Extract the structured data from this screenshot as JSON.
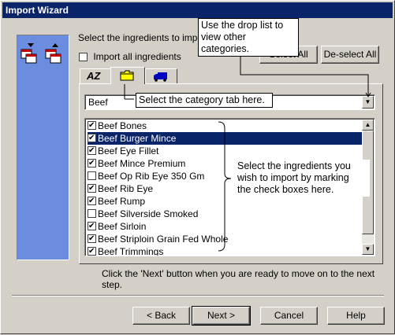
{
  "window": {
    "title": "Import Wizard",
    "close_glyph": "×"
  },
  "side_panel": {
    "icon_names": [
      "export-tables-icon",
      "import-tables-icon"
    ]
  },
  "instruction": "Select the ingredients to import.",
  "import_all": {
    "label": "Import all ingredients",
    "checked": false
  },
  "buttons": {
    "select_all": "Select All",
    "deselect_all": "De-select All"
  },
  "tabs": [
    {
      "name": "alphabetical-tab",
      "icon": "az-sort-icon",
      "glyph": "AZ"
    },
    {
      "name": "category-tab",
      "icon": "folder-icon",
      "active": true
    },
    {
      "name": "supplier-tab",
      "icon": "truck-icon"
    }
  ],
  "category_select": {
    "value": "Beef"
  },
  "ingredients": [
    {
      "label": "Beef Bones",
      "checked": true,
      "selected": false
    },
    {
      "label": "Beef Burger Mince",
      "checked": true,
      "selected": true
    },
    {
      "label": "Beef Eye Fillet",
      "checked": true,
      "selected": false
    },
    {
      "label": "Beef Mince Premium",
      "checked": true,
      "selected": false
    },
    {
      "label": "Beef Op Rib Eye 350 Gm",
      "checked": false,
      "selected": false
    },
    {
      "label": "Beef Rib Eye",
      "checked": true,
      "selected": false
    },
    {
      "label": "Beef Rump",
      "checked": true,
      "selected": false
    },
    {
      "label": "Beef Silverside Smoked",
      "checked": false,
      "selected": false
    },
    {
      "label": "Beef Sirloin",
      "checked": true,
      "selected": false
    },
    {
      "label": "Beef Striploin Grain Fed Whole",
      "checked": true,
      "selected": false
    },
    {
      "label": "Beef Trimmings",
      "checked": true,
      "selected": false
    }
  ],
  "callouts": {
    "droplist_line1": "Use the drop list to",
    "droplist_line2": "view other categories.",
    "category_tab": "Select the category tab here.",
    "checkbox_line1": "Select the ingredients you",
    "checkbox_line2": "wish to import by marking",
    "checkbox_line3": "the check boxes here."
  },
  "footer_hint": "Click the 'Next' button when you are ready to move on to the next step.",
  "nav_buttons": {
    "back": "< Back",
    "next": "Next >",
    "cancel": "Cancel",
    "help": "Help"
  },
  "colors": {
    "title_bar": "#0a246a",
    "side_panel": "#6b8de0",
    "face": "#d4d0c8",
    "selection": "#0a246a"
  }
}
